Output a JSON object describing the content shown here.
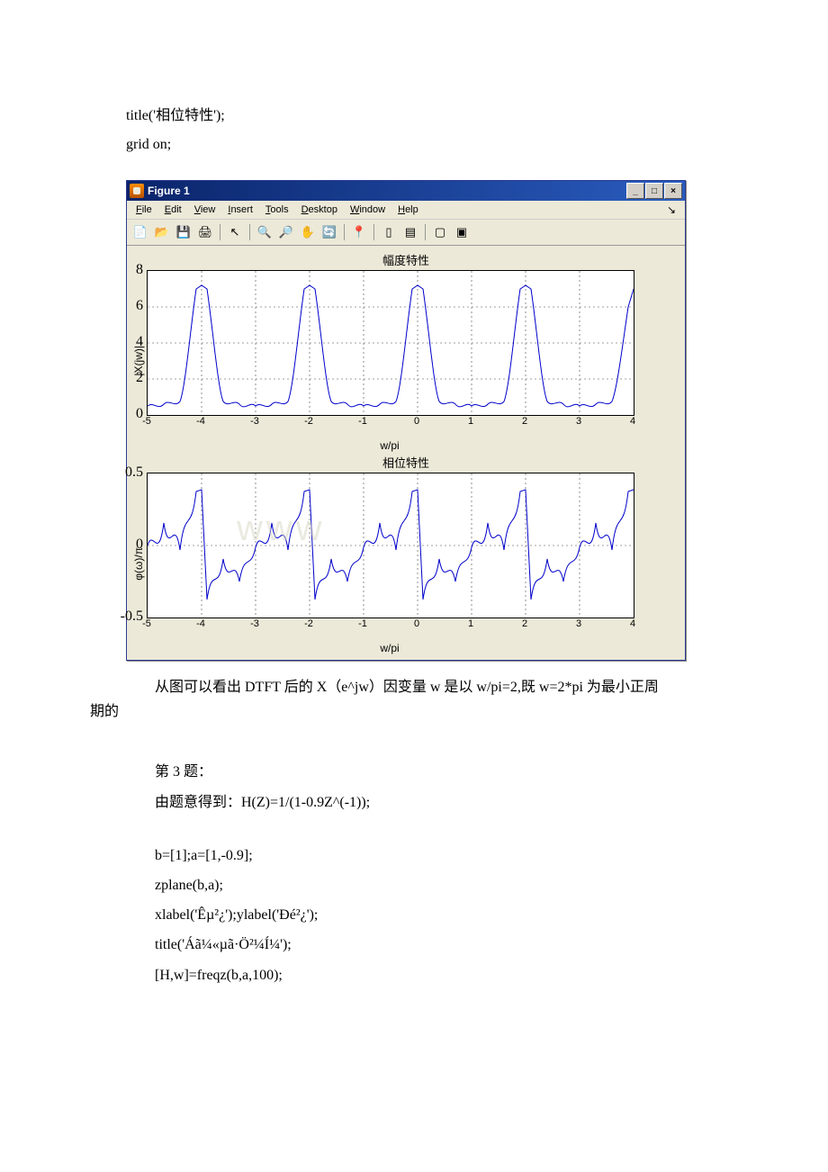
{
  "code_above": {
    "line1": "title('相位特性');",
    "line2": "grid on;"
  },
  "figure_window": {
    "title": "Figure 1",
    "win_buttons": {
      "min": "_",
      "max": "□",
      "close": "×"
    },
    "menu": {
      "file": "File",
      "edit": "Edit",
      "view": "View",
      "insert": "Insert",
      "tools": "Tools",
      "desktop": "Desktop",
      "window": "Window",
      "help": "Help"
    },
    "toolbar_icons": {
      "new": "new-file-icon",
      "open": "open-file-icon",
      "save": "save-icon",
      "print": "print-icon",
      "arrow": "pointer-icon",
      "zoomin": "zoom-in-icon",
      "zoomout": "zoom-out-icon",
      "pan": "pan-icon",
      "rotate": "rotate-icon",
      "datacursor": "data-cursor-icon",
      "colorbar": "colorbar-icon",
      "legend": "legend-icon",
      "sep": "separator",
      "hide": "hide-plot-icon",
      "dock": "dock-icon"
    }
  },
  "chart_data": [
    {
      "type": "line",
      "title": "幅度特性",
      "xlabel": "w/pi",
      "ylabel": "|X(jw)|",
      "xlim": [
        -5,
        4
      ],
      "ylim": [
        0,
        8
      ],
      "xticks": [
        -5,
        -4,
        -3,
        -2,
        -1,
        0,
        1,
        2,
        3,
        4
      ],
      "yticks": [
        0,
        2,
        4,
        6,
        8
      ],
      "series": [
        {
          "name": "magnitude",
          "period": 2,
          "description": "Repeating DTFT magnitude with tall narrow peaks near w/pi = ... -4, -2, 0, 2, 4 reaching ≈7, low ripple floor ≈0.5–1.5 between peaks",
          "peak_value": 7,
          "floor_value": 0.5
        }
      ]
    },
    {
      "type": "line",
      "title": "相位特性",
      "xlabel": "w/pi",
      "ylabel": "φ(ω)/π",
      "xlim": [
        -5,
        4
      ],
      "ylim": [
        -0.5,
        0.5
      ],
      "xticks": [
        -5,
        -4,
        -3,
        -2,
        -1,
        0,
        1,
        2,
        3,
        4
      ],
      "yticks": [
        -0.5,
        0,
        0.5
      ],
      "series": [
        {
          "name": "phase",
          "period": 2,
          "description": "Repeating DTFT phase oscillating between ≈-0.5 and +0.5 with ripple, rising segment then drop each period"
        }
      ]
    }
  ],
  "paragraph": {
    "line1": "从图可以看出 DTFT 后的 X（e^jw）因变量 w 是以 w/pi=2,既 w=2*pi 为最小正周",
    "line2": "期的"
  },
  "section3": {
    "header": "第 3 题：",
    "given": "由题意得到：H(Z)=1/(1-0.9Z^(-1));",
    "code": [
      "b=[1];a=[1,-0.9];",
      "zplane(b,a);",
      "xlabel('Êµ²¿');ylabel('Ðé²¿');",
      "title('Áã¼«µã·Ö²¼Í¼');",
      "[H,w]=freqz(b,a,100);"
    ]
  },
  "watermark": "www"
}
